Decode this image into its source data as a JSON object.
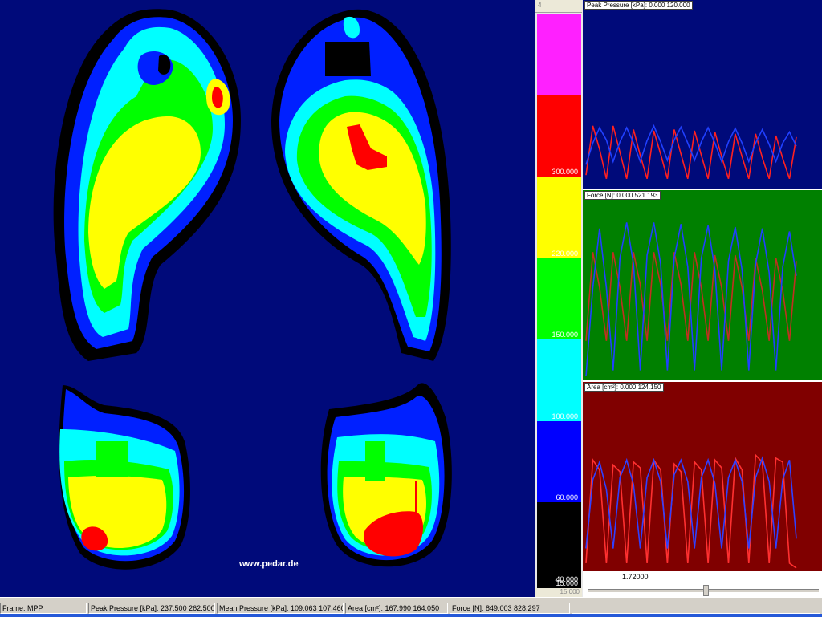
{
  "footmap": {
    "watermark": "www.pedar.de"
  },
  "scale": {
    "top_label": "4",
    "bottom_label": "15.000",
    "bands": [
      {
        "label": "",
        "color": "#ff20ff"
      },
      {
        "label": "300.000",
        "color": "#ff0000"
      },
      {
        "label": "220.000",
        "color": "#ffff00"
      },
      {
        "label": "150.000",
        "color": "#00ff00"
      },
      {
        "label": "100.000",
        "color": "#00ffff"
      },
      {
        "label": "60.000",
        "color": "#0000ff"
      },
      {
        "label": "40.000",
        "color": "#000000"
      },
      {
        "label": "15.000",
        "color": "#000000"
      }
    ]
  },
  "graphs": {
    "peak": {
      "header": "Peak Pressure [kPa]: 0.000  120.000",
      "bg": "#000a7a"
    },
    "force": {
      "header": "Force [N]: 0.000  521.193",
      "bg": "#008000"
    },
    "area": {
      "header": "Area [cm²]: 0.000  124.150",
      "bg": "#800000"
    },
    "time_value": "1.72000"
  },
  "chart_data": [
    {
      "type": "line",
      "title": "Peak Pressure [kPa]: 0.000  120.000",
      "ylim": [
        0,
        120
      ],
      "series": [
        {
          "color": "#ff2020",
          "values": [
            18,
            98,
            60,
            12,
            98,
            55,
            12,
            92,
            50,
            12,
            90,
            52,
            12,
            92,
            52,
            12,
            90,
            50,
            12,
            88,
            48,
            12,
            85,
            48,
            12,
            85,
            46,
            12,
            82,
            45,
            12,
            80
          ]
        },
        {
          "color": "#2040ff",
          "values": [
            35,
            70,
            95,
            75,
            40,
            72,
            95,
            70,
            40,
            74,
            98,
            72,
            42,
            75,
            96,
            70,
            42,
            72,
            95,
            70,
            40,
            72,
            94,
            70,
            40,
            70,
            92,
            68,
            40,
            70,
            88,
            65
          ]
        }
      ]
    },
    {
      "type": "line",
      "title": "Force [N]: 0.000  521.193",
      "ylim": [
        0,
        521.193
      ],
      "series": [
        {
          "color": "#c03020",
          "values": [
            120,
            420,
            300,
            120,
            420,
            300,
            120,
            420,
            310,
            120,
            420,
            310,
            120,
            420,
            310,
            120,
            420,
            300,
            120,
            410,
            300,
            120,
            410,
            300,
            120,
            400,
            290,
            120,
            400,
            290,
            120,
            390
          ]
        },
        {
          "color": "#2040ff",
          "values": [
            0,
            300,
            500,
            300,
            20,
            400,
            520,
            380,
            20,
            410,
            520,
            380,
            20,
            400,
            515,
            370,
            20,
            400,
            510,
            360,
            20,
            390,
            505,
            360,
            20,
            380,
            500,
            350,
            20,
            370,
            490,
            340
          ]
        }
      ]
    },
    {
      "type": "line",
      "title": "Area [cm²]: 0.000  124.150",
      "ylim": [
        0,
        124.15
      ],
      "series": [
        {
          "color": "#ff3030",
          "values": [
            5,
            110,
            100,
            5,
            105,
            98,
            5,
            108,
            102,
            5,
            110,
            100,
            5,
            106,
            98,
            5,
            108,
            100,
            5,
            110,
            102,
            5,
            112,
            100,
            5,
            115,
            108,
            5,
            112,
            108,
            5,
            0
          ]
        },
        {
          "color": "#3040ff",
          "values": [
            20,
            90,
            108,
            80,
            20,
            92,
            110,
            85,
            20,
            92,
            110,
            88,
            20,
            95,
            110,
            88,
            20,
            92,
            110,
            86,
            20,
            92,
            110,
            88,
            20,
            92,
            112,
            88,
            20,
            90,
            110,
            30
          ]
        }
      ]
    }
  ],
  "status": {
    "frame": "Frame: MPP",
    "peak": "Peak Pressure [kPa]: 237.500   262.500",
    "mean": "Mean Pressure [kPa]: 109.063   107.460",
    "area": "Area [cm²]: 167.990   164.050",
    "force": "Force [N]: 849.003   828.297"
  }
}
